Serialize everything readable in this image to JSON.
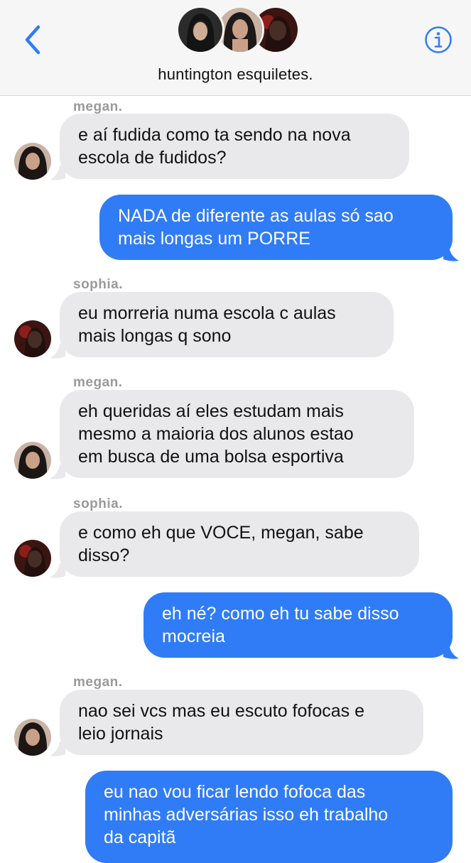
{
  "header": {
    "title": "huntington esquiletes.",
    "back_icon": "chevron-left-icon",
    "info_icon": "info-icon",
    "accent": "#2f7cf6"
  },
  "messages": [
    {
      "sender": "megan.",
      "lines": [
        "e aí fudida como ta sendo na nova",
        "escola de fudidos?"
      ]
    },
    {
      "lines": [
        "NADA de diferente as aulas só sao",
        "mais longas um PORRE"
      ]
    },
    {
      "sender": "sophia.",
      "lines": [
        "eu morreria numa escola c aulas",
        "mais longas q sono"
      ]
    },
    {
      "sender": "megan.",
      "lines": [
        "eh queridas aí eles estudam mais",
        "mesmo a maioria dos alunos estao",
        "em busca de uma bolsa esportiva"
      ]
    },
    {
      "sender": "sophia.",
      "lines": [
        "e como eh que VOCE, megan, sabe",
        "disso?"
      ]
    },
    {
      "lines": [
        "eh né? como eh tu sabe disso",
        "mocreia"
      ]
    },
    {
      "sender": "megan.",
      "lines": [
        "nao sei vcs mas eu escuto fofocas e",
        "leio jornais"
      ]
    },
    {
      "lines": [
        "eu nao vou ficar lendo fofoca das",
        "minhas adversárias isso eh trabalho",
        "da capitã"
      ]
    }
  ]
}
